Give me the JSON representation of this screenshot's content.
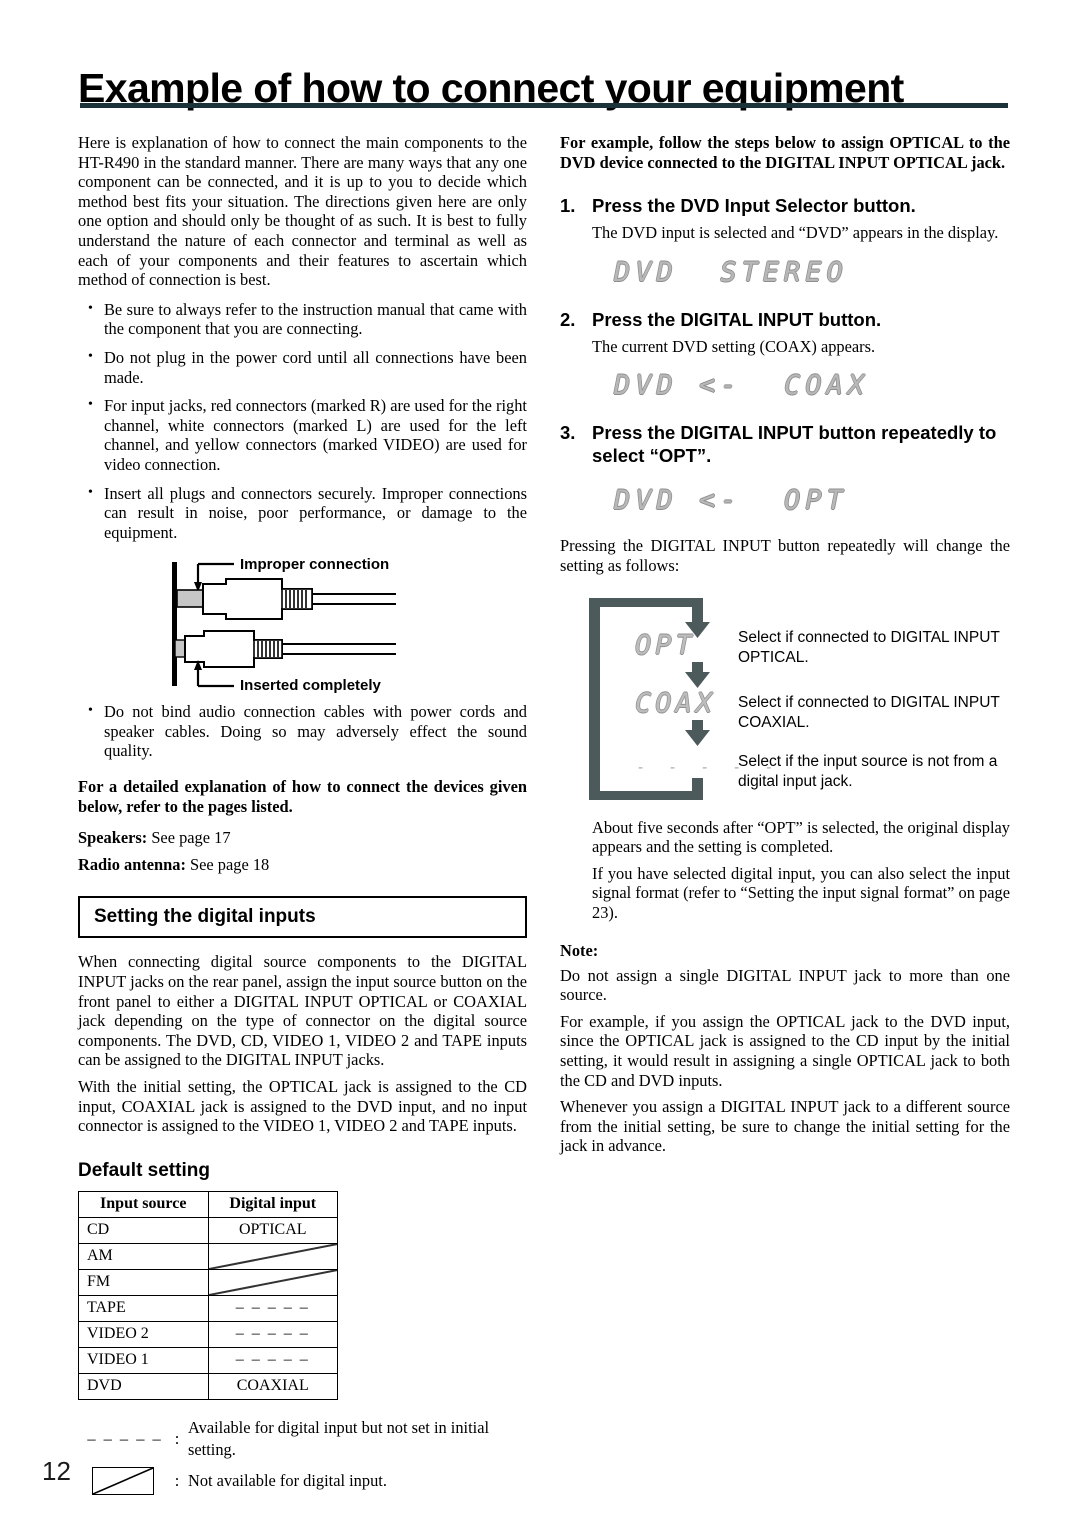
{
  "page": {
    "title": "Example of how to connect your equipment",
    "number": "12",
    "rule_color": "#1b3239"
  },
  "left": {
    "intro": "Here is explanation of how to connect the main components to the HT-R490 in the standard manner. There are many ways that any one component can be connected, and it is up to you to decide which method best fits your situation. The directions given here are only one option and should only be thought of as such. It is best to fully understand the nature of each connector and terminal as well as each of your components and their features to ascertain which method of connection is best.",
    "bullets": [
      "Be sure to always refer to the instruction manual that came with the component that you are connecting.",
      "Do not plug in the power cord until all connections have been made.",
      "For input jacks, red connectors (marked R) are used for the right channel, white connectors (marked L) are used for the left channel, and yellow connectors (marked VIDEO) are used for video connection.",
      "Insert all plugs and connectors securely. Improper connections can result in noise, poor performance, or damage to the equipment."
    ],
    "connector_figure": {
      "label_top": "Improper connection",
      "label_bottom": "Inserted completely"
    },
    "bullet_last": "Do not bind audio connection cables with power cords and speaker cables. Doing so may adversely effect the sound quality.",
    "detail_note": "For a detailed explanation of how to connect the devices given below, refer to the pages listed.",
    "refs": [
      {
        "label": "Speakers:",
        "value": " See page 17"
      },
      {
        "label": "Radio antenna:",
        "value": " See page 18"
      }
    ],
    "section_heading": "Setting the digital inputs",
    "section_paras": [
      "When connecting digital source components to the DIGITAL INPUT jacks on the rear panel, assign the input source button on the front panel to either a DIGITAL INPUT OPTICAL or COAXIAL jack depending on the type of connector on the digital source components. The DVD, CD, VIDEO 1, VIDEO 2 and TAPE inputs can be assigned to the DIGITAL INPUT jacks.",
      "With the initial setting, the OPTICAL jack is assigned to the CD input, COAXIAL jack is assigned to the DVD input, and no input connector is assigned to the VIDEO 1, VIDEO 2 and TAPE inputs."
    ],
    "default_setting_heading": "Default setting",
    "table": {
      "headers": [
        "Input source",
        "Digital input"
      ],
      "rows": [
        {
          "source": "CD",
          "value": "OPTICAL",
          "kind": "text"
        },
        {
          "source": "AM",
          "value": "",
          "kind": "slash"
        },
        {
          "source": "FM",
          "value": "",
          "kind": "slash"
        },
        {
          "source": "TAPE",
          "value": "– – – – –",
          "kind": "dash"
        },
        {
          "source": "VIDEO 2",
          "value": "– – – – –",
          "kind": "dash"
        },
        {
          "source": "VIDEO 1",
          "value": "– – – – –",
          "kind": "dash"
        },
        {
          "source": "DVD",
          "value": "COAXIAL",
          "kind": "text"
        }
      ]
    },
    "legend": [
      {
        "key": "– – – – –",
        "colon": ":",
        "text": "Available for digital input but not set in initial setting."
      },
      {
        "key": "box",
        "colon": ":",
        "text": "Not available for digital input."
      }
    ]
  },
  "right": {
    "lead": "For example, follow the steps below to assign OPTICAL to the DVD device connected to the DIGITAL INPUT OPTICAL jack.",
    "steps": [
      {
        "num": "1.",
        "heading": "Press the DVD Input Selector button.",
        "body": "The DVD input is selected and “DVD” appears in the display.",
        "display": "DVD  STEREO"
      },
      {
        "num": "2.",
        "heading": "Press the DIGITAL INPUT button.",
        "body": "The current DVD setting (COAX) appears.",
        "display": "DVD <-  COAX"
      },
      {
        "num": "3.",
        "heading": "Press the DIGITAL INPUT button repeatedly to select “OPT”.",
        "body": "",
        "display": "DVD <-  OPT"
      }
    ],
    "cycle_intro": "Pressing the DIGITAL INPUT button repeatedly will change the setting as follows:",
    "cycle": [
      {
        "display": "OPT",
        "note": "Select if connected to DIGITAL INPUT OPTICAL."
      },
      {
        "display": "COAX",
        "note": "Select if connected to DIGITAL INPUT COAXIAL."
      },
      {
        "display": "- - - - -",
        "note": "Select if the input source is not from a digital input jack."
      }
    ],
    "after_paras": [
      "About five seconds after “OPT” is selected, the original display appears and the setting is completed.",
      "If you have selected digital input, you can also select the input signal format (refer to “Setting the input signal format” on page 23)."
    ],
    "note_heading": "Note:",
    "note_paras": [
      "Do not assign a single DIGITAL INPUT jack to more than one source.",
      "For example, if you assign the OPTICAL jack to the DVD input, since the OPTICAL jack is assigned to the CD input by the initial setting, it would result in assigning a single OPTICAL jack to both the CD and DVD inputs.",
      "Whenever you assign a DIGITAL INPUT jack to a different source from the initial setting, be sure to change the initial setting for the jack in advance."
    ]
  }
}
